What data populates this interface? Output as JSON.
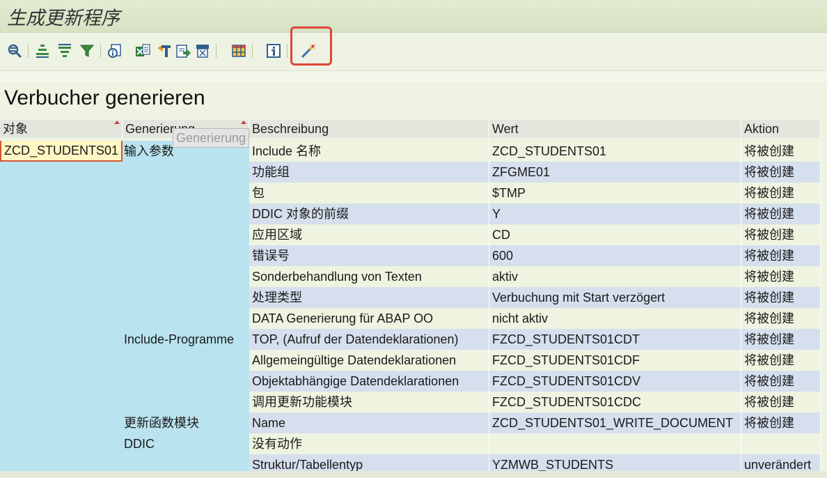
{
  "window": {
    "title": "生成更新程序"
  },
  "toolbar": {
    "icons": [
      "find-icon",
      "sort-ascending-icon",
      "sort-descending-icon",
      "filter-icon",
      "details-icon",
      "export-spreadsheet-icon",
      "sum-icon",
      "send-icon",
      "print-preview-icon",
      "layout-grid-icon",
      "info-icon",
      "generate-wand-icon"
    ],
    "highlighted": "generate-wand-icon"
  },
  "section": {
    "title": "Verbucher generieren"
  },
  "tooltip": "Generierung",
  "table": {
    "headers": [
      "对象",
      "Generierung",
      "Beschreibung",
      "Wert",
      "Aktion"
    ],
    "object": "ZCD_STUDENTS01",
    "groups": [
      {
        "label": "输入参数",
        "row_start": 0
      },
      {
        "label": "Include-Programme",
        "row_start": 9
      },
      {
        "label": "更新函数模块",
        "row_start": 13
      },
      {
        "label": "DDIC",
        "row_start": 14
      }
    ],
    "rows": [
      {
        "desc": "Include 名称",
        "value": "ZCD_STUDENTS01",
        "action": "将被创建"
      },
      {
        "desc": "功能组",
        "value": "ZFGME01",
        "action": "将被创建"
      },
      {
        "desc": "包",
        "value": "$TMP",
        "action": "将被创建"
      },
      {
        "desc": "DDIC 对象的前缀",
        "value": "Y",
        "action": "将被创建"
      },
      {
        "desc": "应用区域",
        "value": "CD",
        "action": "将被创建"
      },
      {
        "desc": "错误号",
        "value": "600",
        "action": "将被创建"
      },
      {
        "desc": "Sonderbehandlung von Texten",
        "value": "aktiv",
        "action": "将被创建"
      },
      {
        "desc": "处理类型",
        "value": "Verbuchung mit Start verzögert",
        "action": "将被创建"
      },
      {
        "desc": "DATA Generierung für ABAP OO",
        "value": "nicht aktiv",
        "action": "将被创建"
      },
      {
        "desc": "TOP, (Aufruf der Datendeklarationen)",
        "value": "FZCD_STUDENTS01CDT",
        "action": "将被创建"
      },
      {
        "desc": "Allgemeingültige Datendeklarationen",
        "value": "FZCD_STUDENTS01CDF",
        "action": "将被创建"
      },
      {
        "desc": "Objektabhängige Datendeklarationen",
        "value": "FZCD_STUDENTS01CDV",
        "action": "将被创建"
      },
      {
        "desc": "调用更新功能模块",
        "value": "FZCD_STUDENTS01CDC",
        "action": "将被创建"
      },
      {
        "desc": "Name",
        "value": "ZCD_STUDENTS01_WRITE_DOCUMENT",
        "action": "将被创建"
      },
      {
        "desc": "没有动作",
        "value": "",
        "action": ""
      },
      {
        "desc": "Struktur/Tabellentyp",
        "value": "YZMWB_STUDENTS",
        "action": "unverändert"
      }
    ]
  },
  "colors": {
    "title_bg": "#dbe5c9",
    "header_bg": "#e2e6dc",
    "group_bg": "#b9e3ef",
    "object_bg": "#fff6c4",
    "row_odd": "#eef4df",
    "row_even": "#d6dfee",
    "highlight_border": "#e0463a"
  }
}
